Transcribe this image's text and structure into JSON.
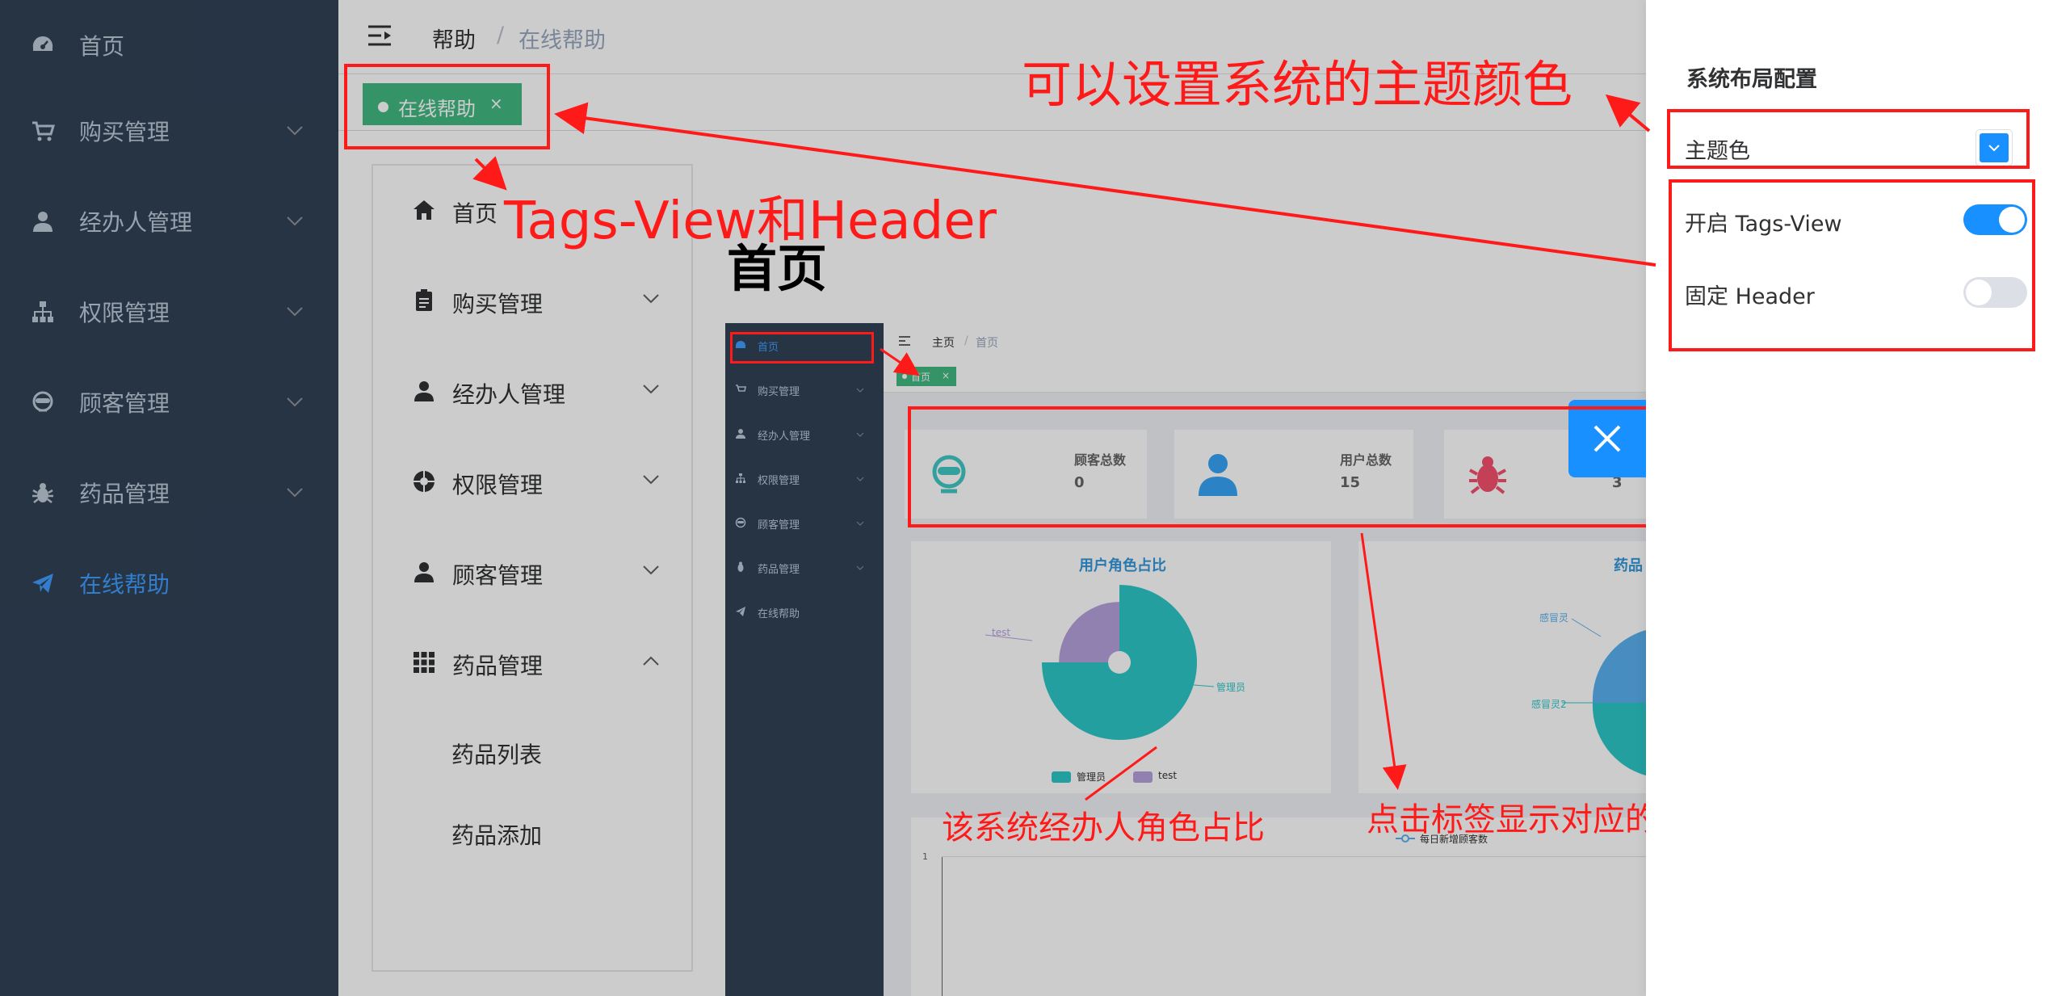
{
  "sidebar": {
    "items": [
      {
        "label": "首页",
        "icon": "dashboard-icon"
      },
      {
        "label": "购买管理",
        "icon": "cart-icon"
      },
      {
        "label": "经办人管理",
        "icon": "user-icon"
      },
      {
        "label": "权限管理",
        "icon": "tree-icon"
      },
      {
        "label": "顾客管理",
        "icon": "customer-icon"
      },
      {
        "label": "药品管理",
        "icon": "bug-icon"
      },
      {
        "label": "在线帮助",
        "icon": "send-icon"
      }
    ]
  },
  "header": {
    "breadcrumb": [
      "帮助",
      "在线帮助"
    ],
    "separator": "/"
  },
  "tags_view": {
    "active_tag": "在线帮助",
    "close_glyph": "×"
  },
  "help_menu": {
    "items": [
      {
        "label": "首页",
        "icon": "home-icon"
      },
      {
        "label": "购买管理",
        "icon": "clipboard-icon"
      },
      {
        "label": "经办人管理",
        "icon": "person-icon"
      },
      {
        "label": "权限管理",
        "icon": "aperture-icon"
      },
      {
        "label": "顾客管理",
        "icon": "person-icon"
      },
      {
        "label": "药品管理",
        "icon": "grid-icon"
      }
    ],
    "sub_items": [
      "药品列表",
      "药品添加"
    ]
  },
  "page_heading": "首页",
  "embedded_screenshot": {
    "sidebar": [
      "首页",
      "购买管理",
      "经办人管理",
      "权限管理",
      "顾客管理",
      "药品管理",
      "在线帮助"
    ],
    "breadcrumb": [
      "主页",
      "首页"
    ],
    "tag": "首页",
    "cards": [
      {
        "title": "顾客总数",
        "value": "0"
      },
      {
        "title": "用户总数",
        "value": "15"
      },
      {
        "title": "",
        "value": "3"
      }
    ],
    "pie_title": "用户角色占比",
    "pie_labels": [
      "test",
      "管理员"
    ],
    "legend": [
      "管理员",
      "test"
    ],
    "second_chart_title": "药品",
    "second_chart_labels": [
      "感冒灵",
      "感冒灵2"
    ],
    "line_legend": "每日新增顾客数",
    "line_axis_tick": "1"
  },
  "chart_data": {
    "type": "pie",
    "title": "用户角色占比",
    "categories": [
      "管理员",
      "test"
    ],
    "values": [
      75,
      25
    ]
  },
  "drawer": {
    "title": "系统布局配置",
    "theme_label": "主题色",
    "theme_color": "#1890ff",
    "tags_view_label": "开启 Tags-View",
    "tags_view_on": true,
    "fixed_header_label": "固定 Header",
    "fixed_header_on": false
  },
  "annotations": {
    "theme": "可以设置系统的主题颜色",
    "tags_header": "Tags-View和Header",
    "pie": "该系统经办人角色占比",
    "click_tag": "点击标签显示对应的"
  },
  "colors": {
    "sidebar_bg": "#304156",
    "active": "#409eff",
    "tag_green": "#42b983",
    "annotation_red": "#ff1a1a",
    "pie_teal": "#2ec7c9",
    "pie_purple": "#b6a2de"
  }
}
